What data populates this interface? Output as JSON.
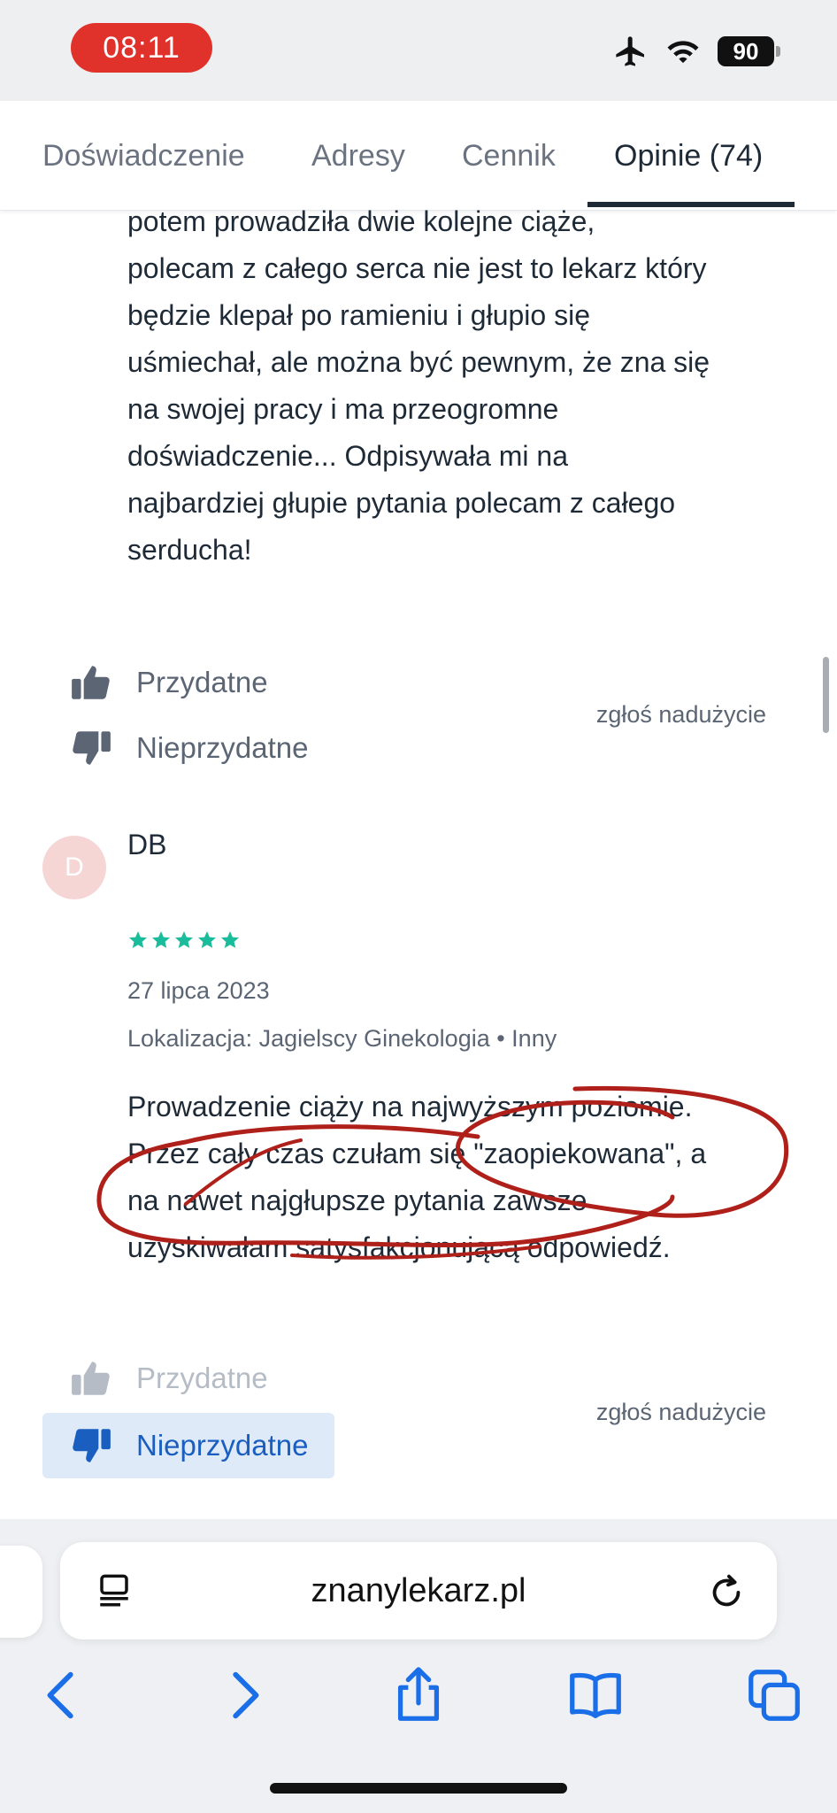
{
  "status_bar": {
    "time": "08:11",
    "battery": "90"
  },
  "tabs": [
    {
      "label": "Doświadczenie"
    },
    {
      "label": "Adresy"
    },
    {
      "label": "Cennik"
    },
    {
      "label": "Opinie (74)"
    }
  ],
  "review_prev": {
    "text_lines": [
      "potem prowadziła dwie kolejne ciąże,",
      "polecam z całego serca nie jest to lekarz który",
      "będzie klepał po ramieniu i głupio się",
      "uśmiechał, ale można być pewnym, że zna się",
      "na swojej pracy i ma przeogromne",
      "doświadczenie... Odpisywała mi na",
      "najbardziej głupie pytania polecam z całego",
      "serducha!"
    ],
    "helpful_label": "Przydatne",
    "not_helpful_label": "Nieprzydatne",
    "report_label": "zgłoś nadużycie"
  },
  "review": {
    "avatar_initial": "D",
    "author": "DB",
    "rating": 5,
    "date": "27 lipca 2023",
    "location": "Lokalizacja: Jagielscy Ginekologia • Inny",
    "text_lines": [
      "Prowadzenie ciąży na najwyższym poziomie.",
      "Przez cały czas czułam się \"zaopiekowana\", a",
      "na nawet najgłupsze pytania zawsze",
      "uzyskiwałam satysfakcjonującą odpowiedź."
    ],
    "helpful_label": "Przydatne",
    "not_helpful_label": "Nieprzydatne",
    "report_label": "zgłoś nadużycie"
  },
  "browser": {
    "url": "znanylekarz.pl"
  },
  "icons": {
    "airplane": "airplane-icon",
    "wifi": "wifi-icon",
    "thumb_up": "thumbs-up-icon",
    "thumb_down": "thumbs-down-icon",
    "reader": "reader-mode-icon",
    "reload": "reload-icon",
    "back": "back-chevron-icon",
    "forward": "forward-chevron-icon",
    "share": "share-icon",
    "bookmarks": "bookmarks-icon",
    "tabs": "tabs-icon"
  },
  "colors": {
    "time_pill": "#e0322b",
    "star": "#1bbc9b",
    "selected_bg": "#dfeaf9",
    "selected_text": "#1a5fbf",
    "annotation": "#b0201a"
  }
}
